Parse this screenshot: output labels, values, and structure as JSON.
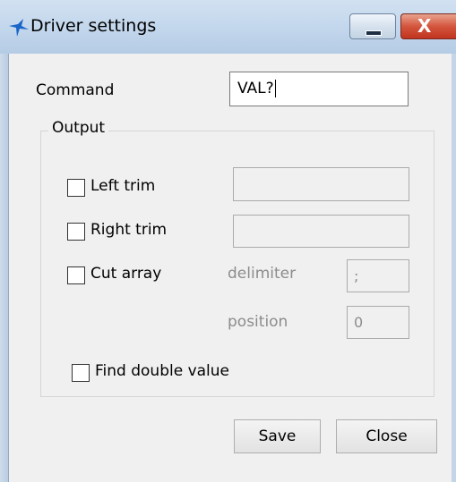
{
  "window": {
    "title": "Driver settings",
    "icon": "bird-icon",
    "minimize_icon": "minimize-icon",
    "close_icon": "close-icon",
    "close_glyph": "X"
  },
  "form": {
    "command_label": "Command",
    "command_value": "VAL?",
    "output_group_label": "Output",
    "left_trim_label": "Left trim",
    "left_trim_value": "",
    "right_trim_label": "Right trim",
    "right_trim_value": "",
    "cut_array_label": "Cut array",
    "delimiter_label": "delimiter",
    "delimiter_value": ";",
    "position_label": "position",
    "position_value": "0",
    "find_double_label": "Find double value"
  },
  "buttons": {
    "save": "Save",
    "close": "Close"
  },
  "colors": {
    "accent": "#1a66c8",
    "close_button": "#c8402b"
  }
}
